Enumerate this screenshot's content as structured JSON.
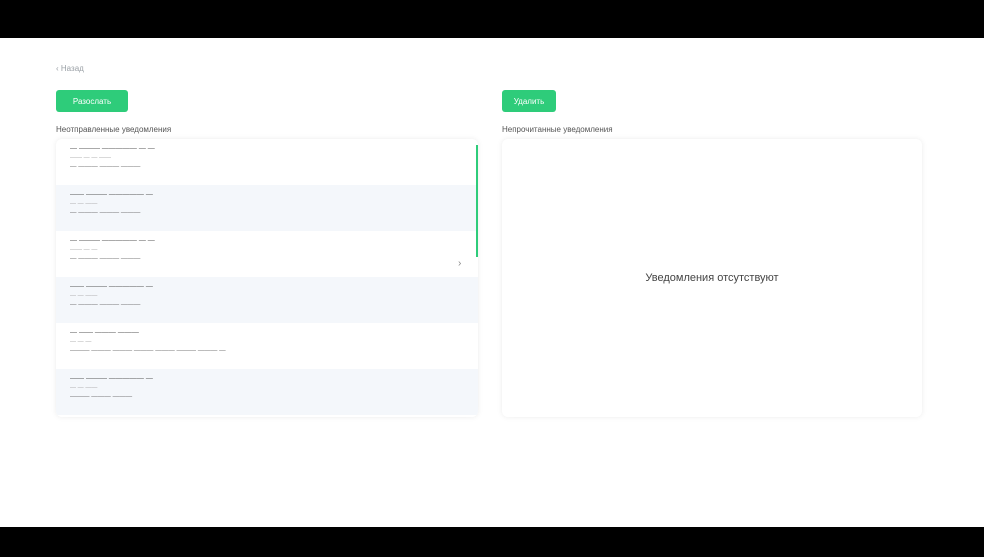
{
  "nav": {
    "back_label": "‹ Назад"
  },
  "left": {
    "button_label": "Разослать",
    "section_label": "Неотправленные уведомления",
    "items": [
      {
        "title": "— ——— ————— — —",
        "subtitle": "—— — — ——",
        "text": "— ——— ——— ———"
      },
      {
        "title": "—— ——— ————— —",
        "subtitle": "— — ——",
        "text": "— ——— ——— ———"
      },
      {
        "title": "— ——— ————— — —",
        "subtitle": "—— — —",
        "text": "— ——— ——— ———"
      },
      {
        "title": "—— ——— ————— —",
        "subtitle": "— — ——",
        "text": "— ——— ——— ———"
      },
      {
        "title": "— —— ——— ———",
        "subtitle": "— — —",
        "text": "——— ——— ——— ——— ——— ——— ——— —"
      },
      {
        "title": "—— ——— ————— —",
        "subtitle": "— — ——",
        "text": "——— ——— ———"
      }
    ],
    "collapse_icon": "chevron-right-icon"
  },
  "right": {
    "button_label": "Удалить",
    "section_label": "Непрочитанные уведомления",
    "empty_message": "Уведомления отсутствуют"
  },
  "colors": {
    "accent": "#2ecc7a",
    "bar": "#000000"
  }
}
